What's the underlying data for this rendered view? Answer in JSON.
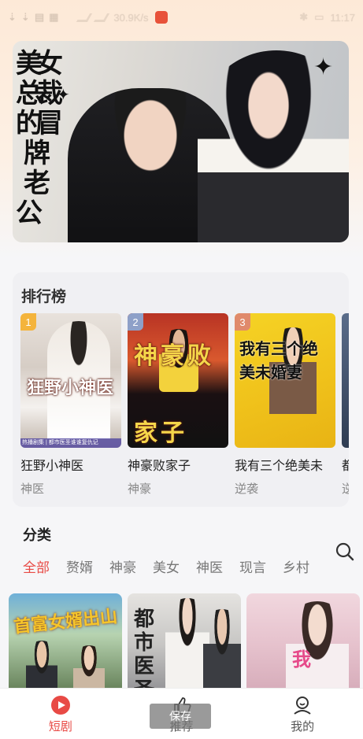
{
  "status_bar": {
    "network_speed": "30.9K/s",
    "time": "11:17"
  },
  "banner": {
    "title_chars": [
      "美",
      "女",
      "总",
      "裁",
      "的",
      "冒",
      "牌",
      "老",
      "公"
    ]
  },
  "ranking": {
    "title": "排行榜",
    "items": [
      {
        "rank": "1",
        "name": "狂野小神医",
        "tag": "神医",
        "poster_text": "狂野小神医",
        "rank_color": "#f4b43c",
        "strip": "热播剧集 | 都市医圣谁谁复仇记"
      },
      {
        "rank": "2",
        "name": "神豪败家子",
        "tag": "神豪",
        "poster_text": "神豪败家子",
        "rank_color": "#8ea0c8"
      },
      {
        "rank": "3",
        "name": "我有三个绝美未",
        "tag": "逆袭",
        "poster_text": "我有三个绝美未婚妻",
        "rank_color": "#e08a6b"
      },
      {
        "rank": "",
        "name": "都",
        "tag": "逆"
      }
    ]
  },
  "category": {
    "title": "分类",
    "tabs": [
      "全部",
      "赘婿",
      "神豪",
      "美女",
      "神医",
      "现言",
      "乡村"
    ],
    "active_tab": "全部"
  },
  "grid": [
    {
      "poster_text": "首富女婿出山"
    },
    {
      "poster_text": "都市医圣"
    },
    {
      "poster_text": "我"
    }
  ],
  "bottom_nav": {
    "items": [
      {
        "label": "短剧",
        "icon": "play-circle-icon"
      },
      {
        "label": "推荐",
        "icon": "thumbs-up-icon"
      },
      {
        "label": "我的",
        "icon": "user-icon"
      }
    ]
  },
  "toast": {
    "text": "保存"
  },
  "colors": {
    "accent": "#e84a45",
    "banner_bg": "#fde9d7"
  }
}
